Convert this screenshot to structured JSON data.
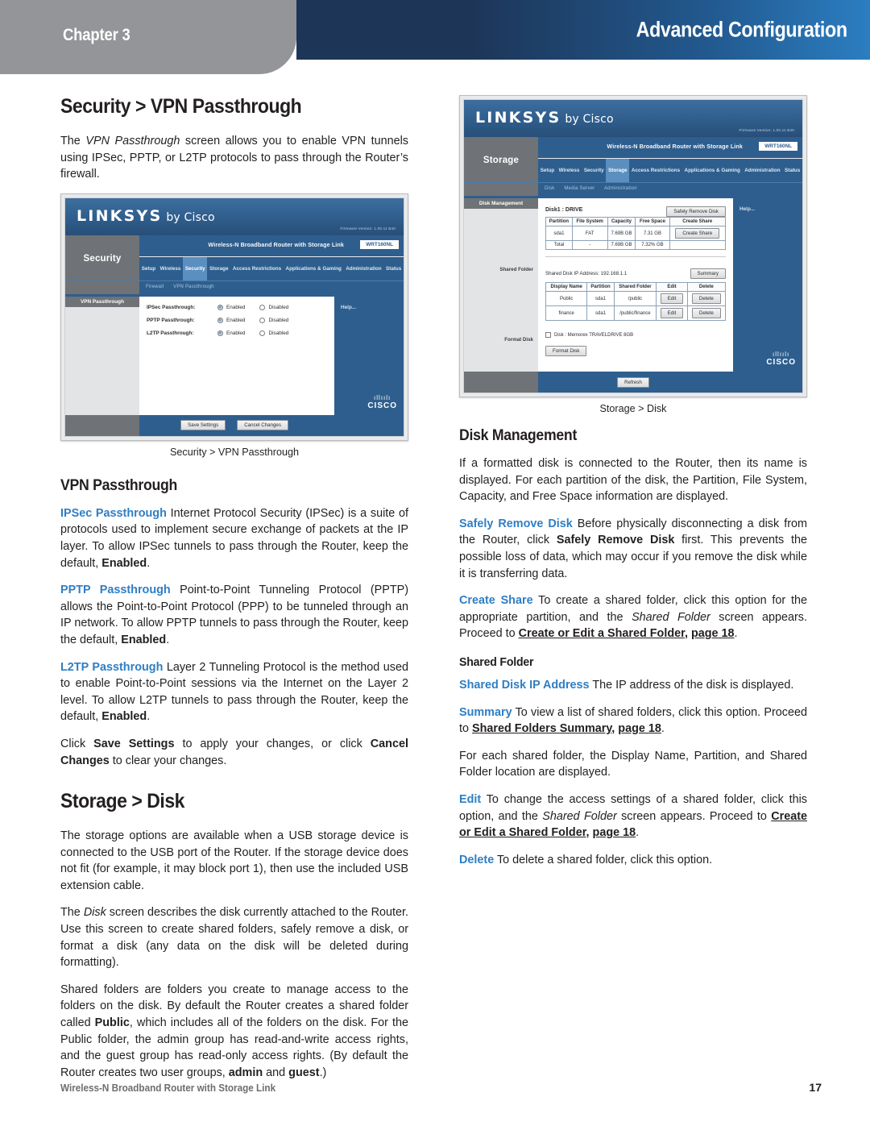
{
  "header": {
    "chapter_label": "Chapter 3",
    "title": "Advanced Configuration",
    "banner_color_start": "#1d3557",
    "banner_color_end": "#2b7ec1",
    "tab_color": "#939598"
  },
  "footer": {
    "document_name": "Wireless-N Broadband Router with Storage Link",
    "page_number": "17"
  },
  "accent_color": "#2e7ec4",
  "left_column": {
    "section_title": "Security > VPN Passthrough",
    "intro_paragraph": {
      "part1": "The ",
      "italic": "VPN Passthrough",
      "part2": " screen allows you to enable VPN tunnels using IPSec, PPTP, or L2TP protocols to pass through the Router’s firewall."
    },
    "figure_caption": "Security > VPN Passthrough",
    "subsection_title": "VPN Passthrough",
    "ipsec": {
      "term": "IPSec Passthrough",
      "text_a": " Internet Protocol Security (IPSec) is a suite of protocols used to implement secure exchange of packets at the IP layer. To allow IPSec tunnels to pass through the Router, keep the default, ",
      "bold_b": "Enabled",
      "text_c": "."
    },
    "pptp": {
      "term": "PPTP Passthrough",
      "text_a": " Point-to-Point Tunneling Protocol (PPTP) allows the Point-to-Point Protocol (PPP) to be tunneled through an IP network. To allow PPTP tunnels to pass through the Router, keep the default, ",
      "bold_b": "Enabled",
      "text_c": "."
    },
    "l2tp": {
      "term": "L2TP Passthrough",
      "text_a": " Layer 2 Tunneling Protocol is the method used to enable Point-to-Point sessions via the Internet on the Layer 2 level. To allow L2TP tunnels to pass through the Router, keep the default, ",
      "bold_b": "Enabled",
      "text_c": "."
    },
    "save_paragraph": {
      "a": "Click ",
      "b": "Save Settings",
      "c": " to apply your changes, or click ",
      "d": "Cancel Changes",
      "e": " to clear your changes."
    },
    "storage_section_title": "Storage > Disk",
    "storage_p1": "The storage options are available when a USB storage device is connected to the USB port of the Router. If the storage device does not fit (for example, it may block port 1), then use the included USB extension cable.",
    "storage_p2": {
      "a": "The ",
      "italic": "Disk",
      "b": " screen describes the disk currently attached to the Router. Use this screen to create shared folders, safely remove a disk, or format a disk (any data on the disk will be deleted during formatting)."
    },
    "storage_p3": {
      "a": "Shared folders are folders you create to manage access to the folders on the disk. By default the Router creates a shared folder called ",
      "b": "Public",
      "c": ", which includes all of the folders on the disk. For the Public folder, the admin group has read-and-write access rights, and the guest group has read-only access rights. (By default the Router creates two user groups, ",
      "d": "admin",
      "e": " and ",
      "f": "guest",
      "g": ".)"
    }
  },
  "right_column": {
    "figure_caption": "Storage > Disk",
    "disk_management_title": "Disk Management",
    "disk_p1": "If a formatted disk is connected to the Router, then its name is displayed. For each partition of the disk, the Partition, File System, Capacity, and Free Space information are displayed.",
    "safely_remove": {
      "term": "Safely Remove Disk",
      "a": " Before physically disconnecting a disk from the Router, click ",
      "b": "Safely Remove Disk",
      "c": " first. This prevents the possible loss of data, which may occur if you remove the disk while it is transferring data."
    },
    "create_share": {
      "term": "Create Share",
      "a": "  To create a shared folder, click this option for the appropriate partition, and the ",
      "italic": "Shared Folder",
      "b": " screen appears. Proceed to ",
      "xref": "Create or Edit a Shared Folder",
      "c": ", ",
      "xref_page": "page 18",
      "d": "."
    },
    "shared_folder_title": "Shared Folder",
    "shared_ip": {
      "term": "Shared Disk IP Address",
      "a": " The IP address of the disk is displayed."
    },
    "summary": {
      "term": "Summary",
      "a": "  To view a list of shared folders, click this option. Proceed to ",
      "xref": "Shared Folders Summary",
      "b": ", ",
      "xref_page": "page 18",
      "c": "."
    },
    "each_folder_p": "For each shared folder, the Display Name, Partition, and Shared Folder location are displayed.",
    "edit": {
      "term": "Edit",
      "a": "  To change the access settings of a shared folder, click this option, and the ",
      "italic": "Shared Folder",
      "b": " screen appears. Proceed to ",
      "xref": "Create or Edit a Shared Folder",
      "c": ", ",
      "xref_page": "page 18",
      "d": "."
    },
    "delete": {
      "term": "Delete",
      "a": "  To delete a shared folder, click this option."
    }
  },
  "figure_security": {
    "brand": "LINKSYS",
    "brand_by": "by Cisco",
    "firmware": "Firmware Version: 1.00.11 B40",
    "product_name": "Wireless-N Broadband Router with Storage Link",
    "model": "WRT160NL",
    "section": "Security",
    "tabs": [
      "Setup",
      "Wireless",
      "Security",
      "Storage",
      "Access Restrictions",
      "Applications & Gaming",
      "Administration",
      "Status"
    ],
    "active_tab": "Security",
    "subnav": [
      "Firewall",
      "VPN Passthrough"
    ],
    "side_title": "VPN Passthrough",
    "rows": [
      {
        "label": "IPSec Passthrough:",
        "enabled": "Enabled",
        "disabled": "Disabled",
        "selected": "Enabled"
      },
      {
        "label": "PPTP Passthrough:",
        "enabled": "Enabled",
        "disabled": "Disabled",
        "selected": "Enabled"
      },
      {
        "label": "L2TP Passthrough:",
        "enabled": "Enabled",
        "disabled": "Disabled",
        "selected": "Enabled"
      }
    ],
    "help_link": "Help...",
    "buttons": [
      "Save Settings",
      "Cancel Changes"
    ],
    "cisco_word": "CISCO"
  },
  "figure_storage": {
    "brand": "LINKSYS",
    "brand_by": "by Cisco",
    "firmware": "Firmware Version: 1.00.11 B40",
    "product_name": "Wireless-N Broadband Router with Storage Link",
    "model": "WRT160NL",
    "section": "Storage",
    "tabs": [
      "Setup",
      "Wireless",
      "Security",
      "Storage",
      "Access Restrictions",
      "Applications & Gaming",
      "Administration",
      "Status"
    ],
    "active_tab": "Storage",
    "subnav": [
      "Disk",
      "Media Server",
      "Administration"
    ],
    "side_labels": [
      "Disk Management",
      "Shared Folder",
      "Format Disk"
    ],
    "disk_title": "Disk1 : DRIVE",
    "safely_remove_btn": "Safely Remove Disk",
    "partition_table": {
      "headers": [
        "Partition",
        "File System",
        "Capacity",
        "Free Space",
        "Create Share"
      ],
      "rows": [
        [
          "sda1",
          "FAT",
          "7.69B GB",
          "7.31 GB",
          "Create Share"
        ],
        [
          "Total",
          "-",
          "7.69B GB",
          "7.32% GB",
          ""
        ]
      ]
    },
    "shared_ip_line": "Shared Disk IP Address: 192.168.1.1",
    "summary_btn": "Summary",
    "shared_table": {
      "headers": [
        "Display Name",
        "Partition",
        "Shared Folder",
        "Edit",
        "Delete"
      ],
      "rows": [
        [
          "Public",
          "sda1",
          "/public",
          "Edit",
          "Delete"
        ],
        [
          "finance",
          "sda1",
          "/public/finance",
          "Edit",
          "Delete"
        ]
      ]
    },
    "format_checkbox_label": "Disk : Memorex TRAVELDRIVE 8GB",
    "format_btn": "Format Disk",
    "refresh_btn": "Refresh",
    "help_link": "Help...",
    "cisco_word": "CISCO"
  }
}
